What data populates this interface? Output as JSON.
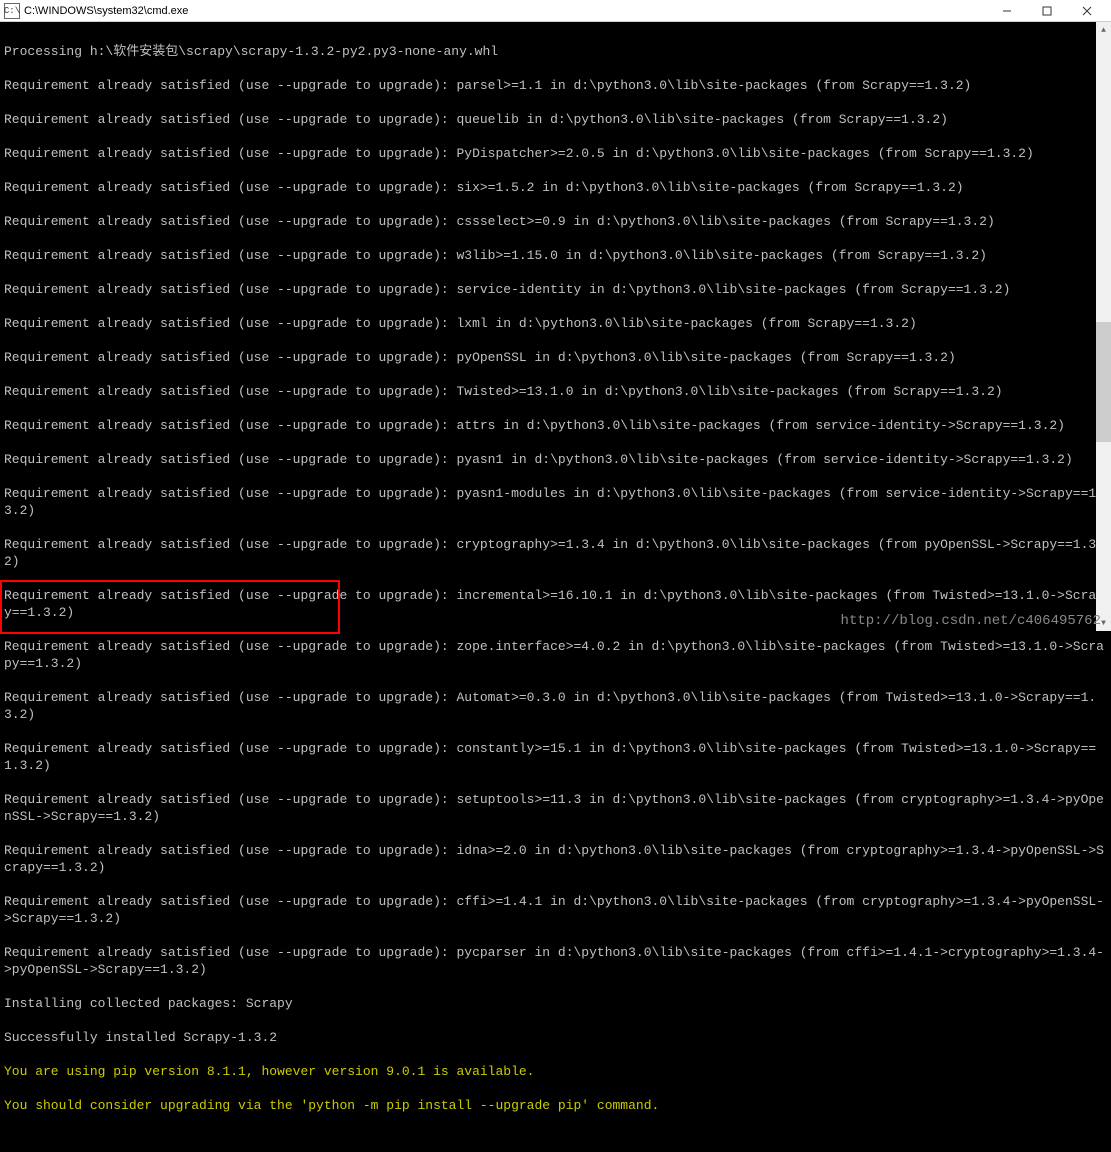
{
  "window": {
    "title": "C:\\WINDOWS\\system32\\cmd.exe",
    "icon_label": "C:\\"
  },
  "terminal": {
    "lines": [
      "Processing h:\\软件安装包\\scrapy\\scrapy-1.3.2-py2.py3-none-any.whl",
      "Requirement already satisfied (use --upgrade to upgrade): parsel>=1.1 in d:\\python3.0\\lib\\site-packages (from Scrapy==1.3.2)",
      "Requirement already satisfied (use --upgrade to upgrade): queuelib in d:\\python3.0\\lib\\site-packages (from Scrapy==1.3.2)",
      "Requirement already satisfied (use --upgrade to upgrade): PyDispatcher>=2.0.5 in d:\\python3.0\\lib\\site-packages (from Scrapy==1.3.2)",
      "Requirement already satisfied (use --upgrade to upgrade): six>=1.5.2 in d:\\python3.0\\lib\\site-packages (from Scrapy==1.3.2)",
      "Requirement already satisfied (use --upgrade to upgrade): cssselect>=0.9 in d:\\python3.0\\lib\\site-packages (from Scrapy==1.3.2)",
      "Requirement already satisfied (use --upgrade to upgrade): w3lib>=1.15.0 in d:\\python3.0\\lib\\site-packages (from Scrapy==1.3.2)",
      "Requirement already satisfied (use --upgrade to upgrade): service-identity in d:\\python3.0\\lib\\site-packages (from Scrapy==1.3.2)",
      "Requirement already satisfied (use --upgrade to upgrade): lxml in d:\\python3.0\\lib\\site-packages (from Scrapy==1.3.2)",
      "Requirement already satisfied (use --upgrade to upgrade): pyOpenSSL in d:\\python3.0\\lib\\site-packages (from Scrapy==1.3.2)",
      "Requirement already satisfied (use --upgrade to upgrade): Twisted>=13.1.0 in d:\\python3.0\\lib\\site-packages (from Scrapy==1.3.2)",
      "Requirement already satisfied (use --upgrade to upgrade): attrs in d:\\python3.0\\lib\\site-packages (from service-identity->Scrapy==1.3.2)",
      "Requirement already satisfied (use --upgrade to upgrade): pyasn1 in d:\\python3.0\\lib\\site-packages (from service-identity->Scrapy==1.3.2)",
      "Requirement already satisfied (use --upgrade to upgrade): pyasn1-modules in d:\\python3.0\\lib\\site-packages (from service-identity->Scrapy==1.3.2)",
      "Requirement already satisfied (use --upgrade to upgrade): cryptography>=1.3.4 in d:\\python3.0\\lib\\site-packages (from pyOpenSSL->Scrapy==1.3.2)",
      "Requirement already satisfied (use --upgrade to upgrade): incremental>=16.10.1 in d:\\python3.0\\lib\\site-packages (from Twisted>=13.1.0->Scrapy==1.3.2)",
      "Requirement already satisfied (use --upgrade to upgrade): zope.interface>=4.0.2 in d:\\python3.0\\lib\\site-packages (from Twisted>=13.1.0->Scrapy==1.3.2)",
      "Requirement already satisfied (use --upgrade to upgrade): Automat>=0.3.0 in d:\\python3.0\\lib\\site-packages (from Twisted>=13.1.0->Scrapy==1.3.2)",
      "Requirement already satisfied (use --upgrade to upgrade): constantly>=15.1 in d:\\python3.0\\lib\\site-packages (from Twisted>=13.1.0->Scrapy==1.3.2)",
      "Requirement already satisfied (use --upgrade to upgrade): setuptools>=11.3 in d:\\python3.0\\lib\\site-packages (from cryptography>=1.3.4->pyOpenSSL->Scrapy==1.3.2)",
      "Requirement already satisfied (use --upgrade to upgrade): idna>=2.0 in d:\\python3.0\\lib\\site-packages (from cryptography>=1.3.4->pyOpenSSL->Scrapy==1.3.2)",
      "Requirement already satisfied (use --upgrade to upgrade): cffi>=1.4.1 in d:\\python3.0\\lib\\site-packages (from cryptography>=1.3.4->pyOpenSSL->Scrapy==1.3.2)",
      "Requirement already satisfied (use --upgrade to upgrade): pycparser in d:\\python3.0\\lib\\site-packages (from cffi>=1.4.1->cryptography>=1.3.4->pyOpenSSL->Scrapy==1.3.2)",
      "Installing collected packages: Scrapy",
      "Successfully installed Scrapy-1.3.2"
    ],
    "yellow_lines": [
      "You are using pip version 8.1.1, however version 9.0.1 is available.",
      "You should consider upgrading via the 'python -m pip install --upgrade pip' command."
    ]
  },
  "watermark": "http://blog.csdn.net/c406495762"
}
